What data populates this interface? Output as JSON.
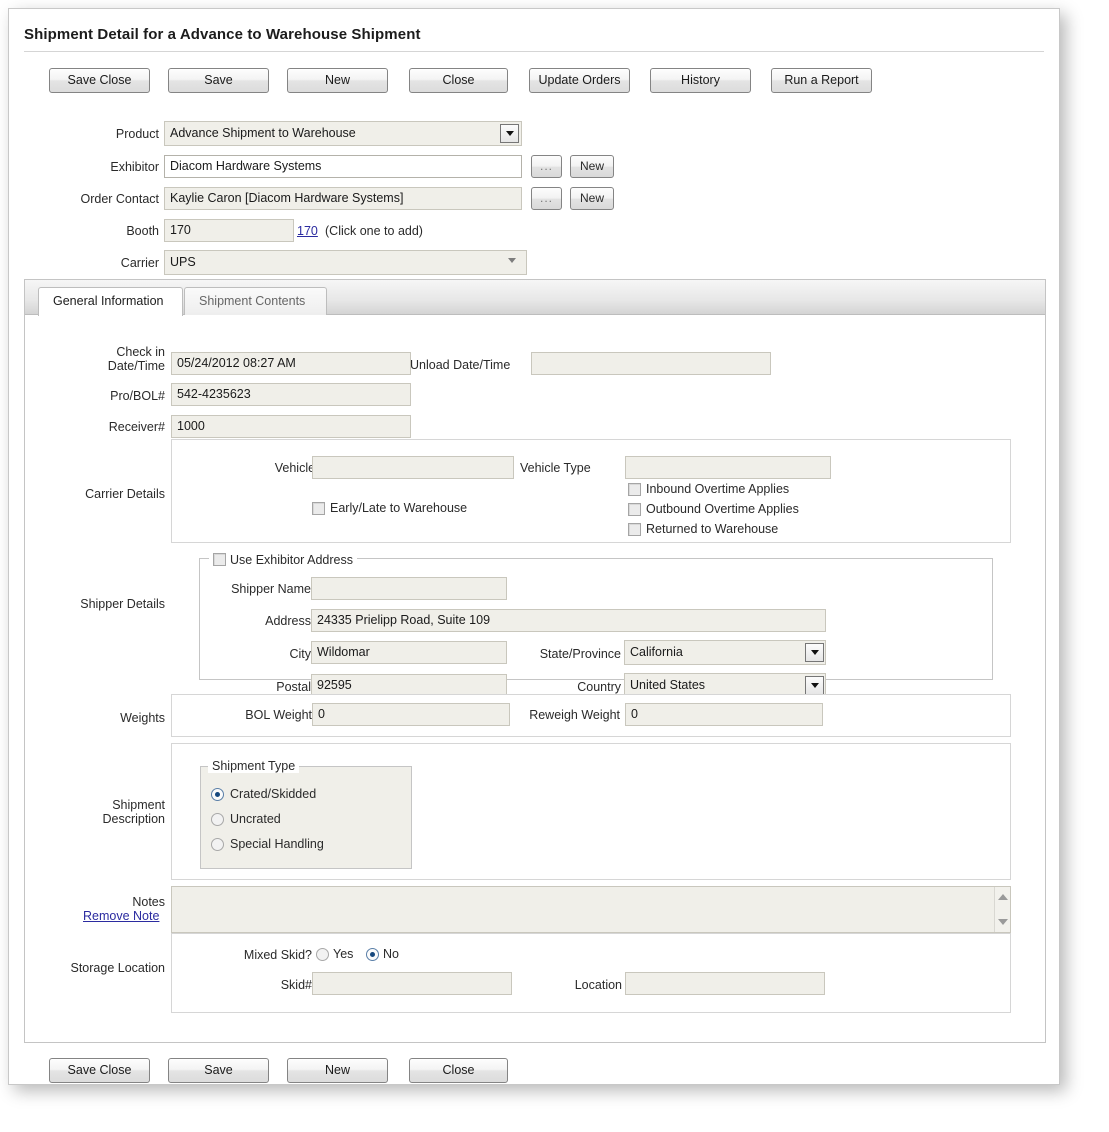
{
  "header": {
    "title": "Shipment Detail for a Advance to Warehouse Shipment"
  },
  "toolbar_top": [
    {
      "label": "Save Close",
      "name": "save-close-button"
    },
    {
      "label": "Save",
      "name": "save-button"
    },
    {
      "label": "New",
      "name": "new-button"
    },
    {
      "label": "Close",
      "name": "close-button"
    },
    {
      "label": "Update Orders",
      "name": "update-orders-button"
    },
    {
      "label": "History",
      "name": "history-button"
    },
    {
      "label": "Run a Report",
      "name": "run-report-button"
    }
  ],
  "toolbar_bottom": [
    {
      "label": "Save Close",
      "name": "save-close-button-bottom"
    },
    {
      "label": "Save",
      "name": "save-button-bottom"
    },
    {
      "label": "New",
      "name": "new-button-bottom"
    },
    {
      "label": "Close",
      "name": "close-button-bottom"
    }
  ],
  "header_form": {
    "product": {
      "label": "Product",
      "value": "Advance Shipment to Warehouse"
    },
    "exhibitor": {
      "label": "Exhibitor",
      "value": "Diacom Hardware Systems",
      "browse_label": "...",
      "new_label": "New"
    },
    "order_contact": {
      "label": "Order Contact",
      "value": "Kaylie Caron [Diacom Hardware Systems]",
      "browse_label": "...",
      "new_label": "New"
    },
    "booth": {
      "label": "Booth",
      "value": "170",
      "link": "170",
      "hint": "(Click one to add)"
    },
    "carrier": {
      "label": "Carrier",
      "value": "UPS"
    }
  },
  "tabs": [
    {
      "label": "General Information",
      "active": true
    },
    {
      "label": "Shipment Contents",
      "active": false
    }
  ],
  "general_information": {
    "check_in": {
      "label_line1": "Check in",
      "label_line2": "Date/Time",
      "value": "05/24/2012 08:27 AM"
    },
    "unload": {
      "label": "Unload Date/Time",
      "value": ""
    },
    "pro_bol": {
      "label": "Pro/BOL#",
      "value": "542-4235623"
    },
    "receiver": {
      "label": "Receiver#",
      "value": "1000"
    },
    "carrier_details": {
      "label": "Carrier Details",
      "vehicle_number": {
        "label": "Vehicle#",
        "value": ""
      },
      "vehicle_type": {
        "label": "Vehicle Type",
        "value": ""
      },
      "checkboxes": [
        {
          "label": "Early/Late to Warehouse",
          "checked": false
        },
        {
          "label": "Inbound Overtime Applies",
          "checked": false
        },
        {
          "label": "Outbound Overtime Applies",
          "checked": false
        },
        {
          "label": "Returned to Warehouse",
          "checked": false
        }
      ]
    },
    "shipper_details": {
      "label": "Shipper Details",
      "use_exhibitor_address": {
        "label": "Use Exhibitor Address",
        "checked": false
      },
      "shipper_name": {
        "label": "Shipper Name",
        "value": ""
      },
      "address": {
        "label": "Address",
        "value": "24335 Prielipp Road, Suite 109"
      },
      "city": {
        "label": "City",
        "value": "Wildomar"
      },
      "state": {
        "label": "State/Province",
        "value": "California"
      },
      "postal": {
        "label": "Postal",
        "value": "92595"
      },
      "country": {
        "label": "Country",
        "value": "United States"
      }
    },
    "weights": {
      "label": "Weights",
      "bol_weight": {
        "label": "BOL Weight",
        "value": "0"
      },
      "reweigh_weight": {
        "label": "Reweigh Weight",
        "value": "0"
      }
    },
    "shipment_description": {
      "label_line1": "Shipment",
      "label_line2": "Description",
      "shipment_type_legend": "Shipment Type",
      "options": [
        {
          "label": "Crated/Skidded",
          "selected": true
        },
        {
          "label": "Uncrated",
          "selected": false
        },
        {
          "label": "Special Handling",
          "selected": false
        }
      ]
    },
    "notes": {
      "label": "Notes",
      "remove_link": "Remove Note",
      "value": ""
    },
    "storage_location": {
      "label": "Storage Location",
      "mixed_skid": {
        "label": "Mixed Skid?",
        "options": [
          {
            "label": "Yes",
            "selected": false
          },
          {
            "label": "No",
            "selected": true
          }
        ]
      },
      "skid_number": {
        "label": "Skid#",
        "value": ""
      },
      "location": {
        "label": "Location",
        "value": ""
      }
    }
  },
  "colors": {
    "field_background": "#f0efe9",
    "link": "#2b2ba0",
    "radio_dot": "#16487e"
  }
}
